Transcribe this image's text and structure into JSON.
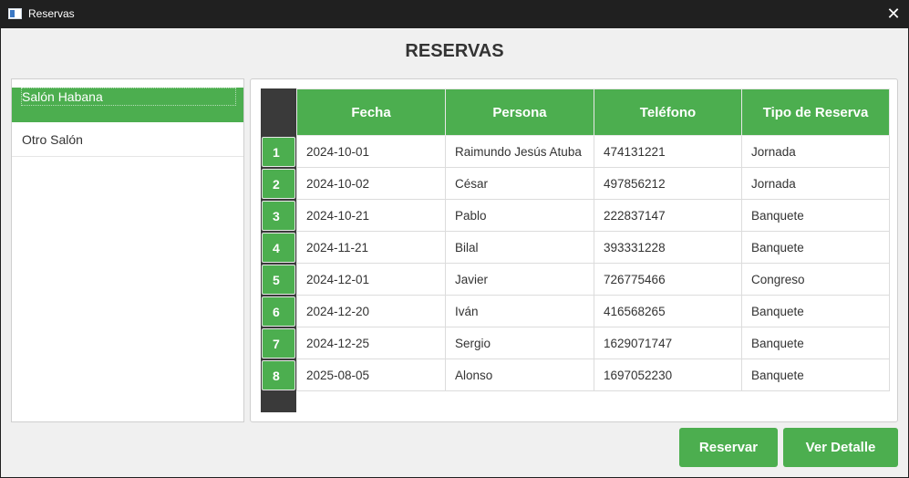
{
  "window": {
    "title": "Reservas",
    "close_glyph": "✕"
  },
  "heading": "RESERVAS",
  "salones": [
    {
      "label": "Salón Habana",
      "selected": true
    },
    {
      "label": "Otro Salón",
      "selected": false
    }
  ],
  "table": {
    "columns": [
      "Fecha",
      "Persona",
      "Teléfono",
      "Tipo de Reserva"
    ],
    "rows": [
      {
        "n": "1",
        "fecha": "2024-10-01",
        "persona": "Raimundo Jesús Atuba",
        "telefono": "474131221",
        "tipo": "Jornada"
      },
      {
        "n": "2",
        "fecha": "2024-10-02",
        "persona": "César",
        "telefono": "497856212",
        "tipo": "Jornada"
      },
      {
        "n": "3",
        "fecha": "2024-10-21",
        "persona": "Pablo",
        "telefono": "222837147",
        "tipo": "Banquete"
      },
      {
        "n": "4",
        "fecha": "2024-11-21",
        "persona": "Bilal",
        "telefono": "393331228",
        "tipo": "Banquete"
      },
      {
        "n": "5",
        "fecha": "2024-12-01",
        "persona": "Javier",
        "telefono": "726775466",
        "tipo": "Congreso"
      },
      {
        "n": "6",
        "fecha": "2024-12-20",
        "persona": "Iván",
        "telefono": "416568265",
        "tipo": "Banquete"
      },
      {
        "n": "7",
        "fecha": "2024-12-25",
        "persona": "Sergio",
        "telefono": "1629071747",
        "tipo": "Banquete"
      },
      {
        "n": "8",
        "fecha": "2025-08-05",
        "persona": "Alonso",
        "telefono": "1697052230",
        "tipo": "Banquete"
      }
    ]
  },
  "buttons": {
    "reservar": "Reservar",
    "ver_detalle": "Ver Detalle"
  },
  "colors": {
    "accent": "#4cae4f",
    "row_header_bg": "#3a3a3a",
    "titlebar_bg": "#202020",
    "window_bg": "#f0f0f0"
  }
}
